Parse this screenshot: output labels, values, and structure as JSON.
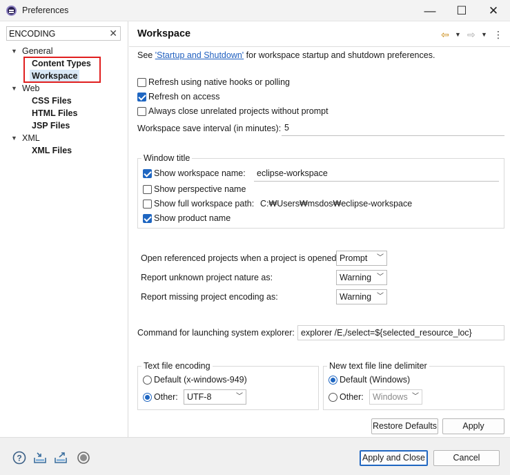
{
  "window": {
    "title": "Preferences",
    "minimize_glyph": "—",
    "maximize_glyph": "☐",
    "close_glyph": "✕"
  },
  "sidebar": {
    "filter_value": "ENCODING",
    "clear_glyph": "✕",
    "tree": [
      {
        "label": "General",
        "kind": "category"
      },
      {
        "label": "Content Types",
        "kind": "leaf"
      },
      {
        "label": "Workspace",
        "kind": "leaf",
        "selected": true
      },
      {
        "label": "Web",
        "kind": "category"
      },
      {
        "label": "CSS Files",
        "kind": "leaf"
      },
      {
        "label": "HTML Files",
        "kind": "leaf"
      },
      {
        "label": "JSP Files",
        "kind": "leaf"
      },
      {
        "label": "XML",
        "kind": "category"
      },
      {
        "label": "XML Files",
        "kind": "leaf"
      }
    ]
  },
  "page": {
    "title": "Workspace",
    "see_prefix": "See ",
    "see_link": "'Startup and Shutdown'",
    "see_suffix": " for workspace startup and shutdown preferences.",
    "options": [
      {
        "label": "Refresh using native hooks or polling",
        "checked": false
      },
      {
        "label": "Refresh on access",
        "checked": true
      },
      {
        "label": "Always close unrelated projects without prompt",
        "checked": false
      }
    ],
    "save_interval_label": "Workspace save interval (in minutes):",
    "save_interval_value": "5",
    "window_title_group": {
      "title": "Window title",
      "show_workspace_name": {
        "label": "Show workspace name:",
        "checked": true,
        "value": "eclipse-workspace"
      },
      "show_perspective_name": {
        "label": "Show perspective name",
        "checked": false
      },
      "show_full_path": {
        "label": "Show full workspace path:",
        "checked": false,
        "value": "C:₩Users₩msdos₩eclipse-workspace"
      },
      "show_product_name": {
        "label": "Show product name",
        "checked": true
      }
    },
    "project_settings": [
      {
        "label": "Open referenced projects when a project is opened:",
        "value": "Prompt"
      },
      {
        "label": "Report unknown project nature as:",
        "value": "Warning"
      },
      {
        "label": "Report missing project encoding as:",
        "value": "Warning"
      }
    ],
    "explorer_label": "Command for launching system explorer:",
    "explorer_value": "explorer /E,/select=${selected_resource_loc}",
    "text_encoding": {
      "title": "Text file encoding",
      "default_label": "Default (x-windows-949)",
      "other_label": "Other:",
      "other_value": "UTF-8",
      "selected": "other"
    },
    "line_delimiter": {
      "title": "New text file line delimiter",
      "default_label": "Default (Windows)",
      "other_label": "Other:",
      "other_value": "Windows",
      "selected": "default"
    },
    "restore_defaults_label": "Restore Defaults",
    "apply_label": "Apply"
  },
  "footer": {
    "apply_close_label": "Apply and Close",
    "cancel_label": "Cancel",
    "icons": [
      "help-icon",
      "import-icon",
      "export-icon",
      "oomph-record-icon"
    ]
  },
  "colors": {
    "accent": "#1f66c1",
    "highlight_border": "#e01e1e",
    "selection": "#d9e8f7",
    "link": "#1f5fbf"
  }
}
